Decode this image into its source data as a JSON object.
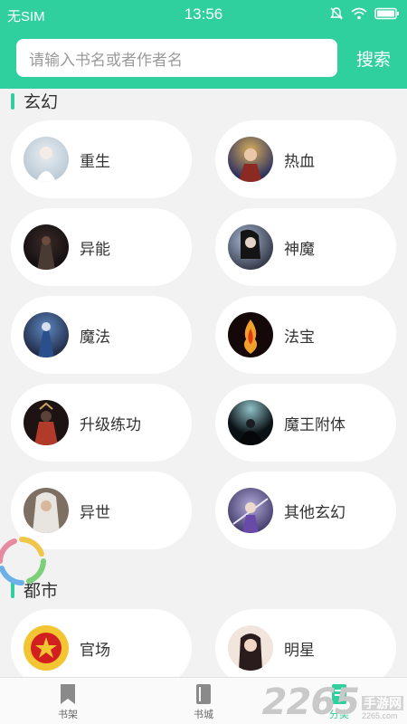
{
  "status_bar": {
    "carrier": "无SIM",
    "time": "13:56"
  },
  "search": {
    "placeholder": "请输入书名或者作者名",
    "button_label": "搜索"
  },
  "sections": [
    {
      "title": "玄幻",
      "items": [
        {
          "label": "重生",
          "avatar": "white-haired-girl-avatar",
          "colors": [
            "#e8eef2",
            "#b9c8d4"
          ]
        },
        {
          "label": "热血",
          "avatar": "armored-warrior-avatar",
          "colors": [
            "#d6ad5c",
            "#2a2f5e"
          ]
        },
        {
          "label": "异能",
          "avatar": "dark-armored-figure-avatar",
          "colors": [
            "#3a2a26",
            "#0e0b10"
          ]
        },
        {
          "label": "神魔",
          "avatar": "black-haired-swordsman-avatar",
          "colors": [
            "#a7b8d4",
            "#2f3342"
          ]
        },
        {
          "label": "魔法",
          "avatar": "blue-mage-avatar",
          "colors": [
            "#5c86bf",
            "#1e2640"
          ]
        },
        {
          "label": "法宝",
          "avatar": "fire-spirit-avatar",
          "colors": [
            "#f0a02c",
            "#140808"
          ]
        },
        {
          "label": "升级练功",
          "avatar": "red-knight-avatar",
          "colors": [
            "#b23a2a",
            "#1d1312"
          ]
        },
        {
          "label": "魔王附体",
          "avatar": "demon-king-avatar",
          "colors": [
            "#8fc0c7",
            "#0b1216"
          ]
        },
        {
          "label": "异世",
          "avatar": "silver-haired-warrior-avatar",
          "colors": [
            "#e8e4df",
            "#7d6f62"
          ]
        },
        {
          "label": "其他玄幻",
          "avatar": "purple-swordswoman-avatar",
          "colors": [
            "#b1a9d8",
            "#3a3260"
          ]
        }
      ]
    },
    {
      "title": "都市",
      "items": [
        {
          "label": "官场",
          "avatar": "red-emblem-avatar",
          "colors": [
            "#f3c533",
            "#d21f1f"
          ]
        },
        {
          "label": "明星",
          "avatar": "actress-avatar",
          "colors": [
            "#f2e5de",
            "#2a1c1c"
          ]
        }
      ]
    }
  ],
  "bottom_nav": [
    {
      "label": "书架",
      "icon": "bookmark-icon",
      "active": false
    },
    {
      "label": "书城",
      "icon": "book-icon",
      "active": false
    },
    {
      "label": "分类",
      "icon": "category-icon",
      "active": true
    }
  ],
  "watermark": {
    "number": "2265",
    "site_cn": "手游网",
    "site_url": "2265.com"
  },
  "colors": {
    "accent": "#2fcf9e",
    "background": "#f2f2f2",
    "chip": "#ffffff"
  }
}
